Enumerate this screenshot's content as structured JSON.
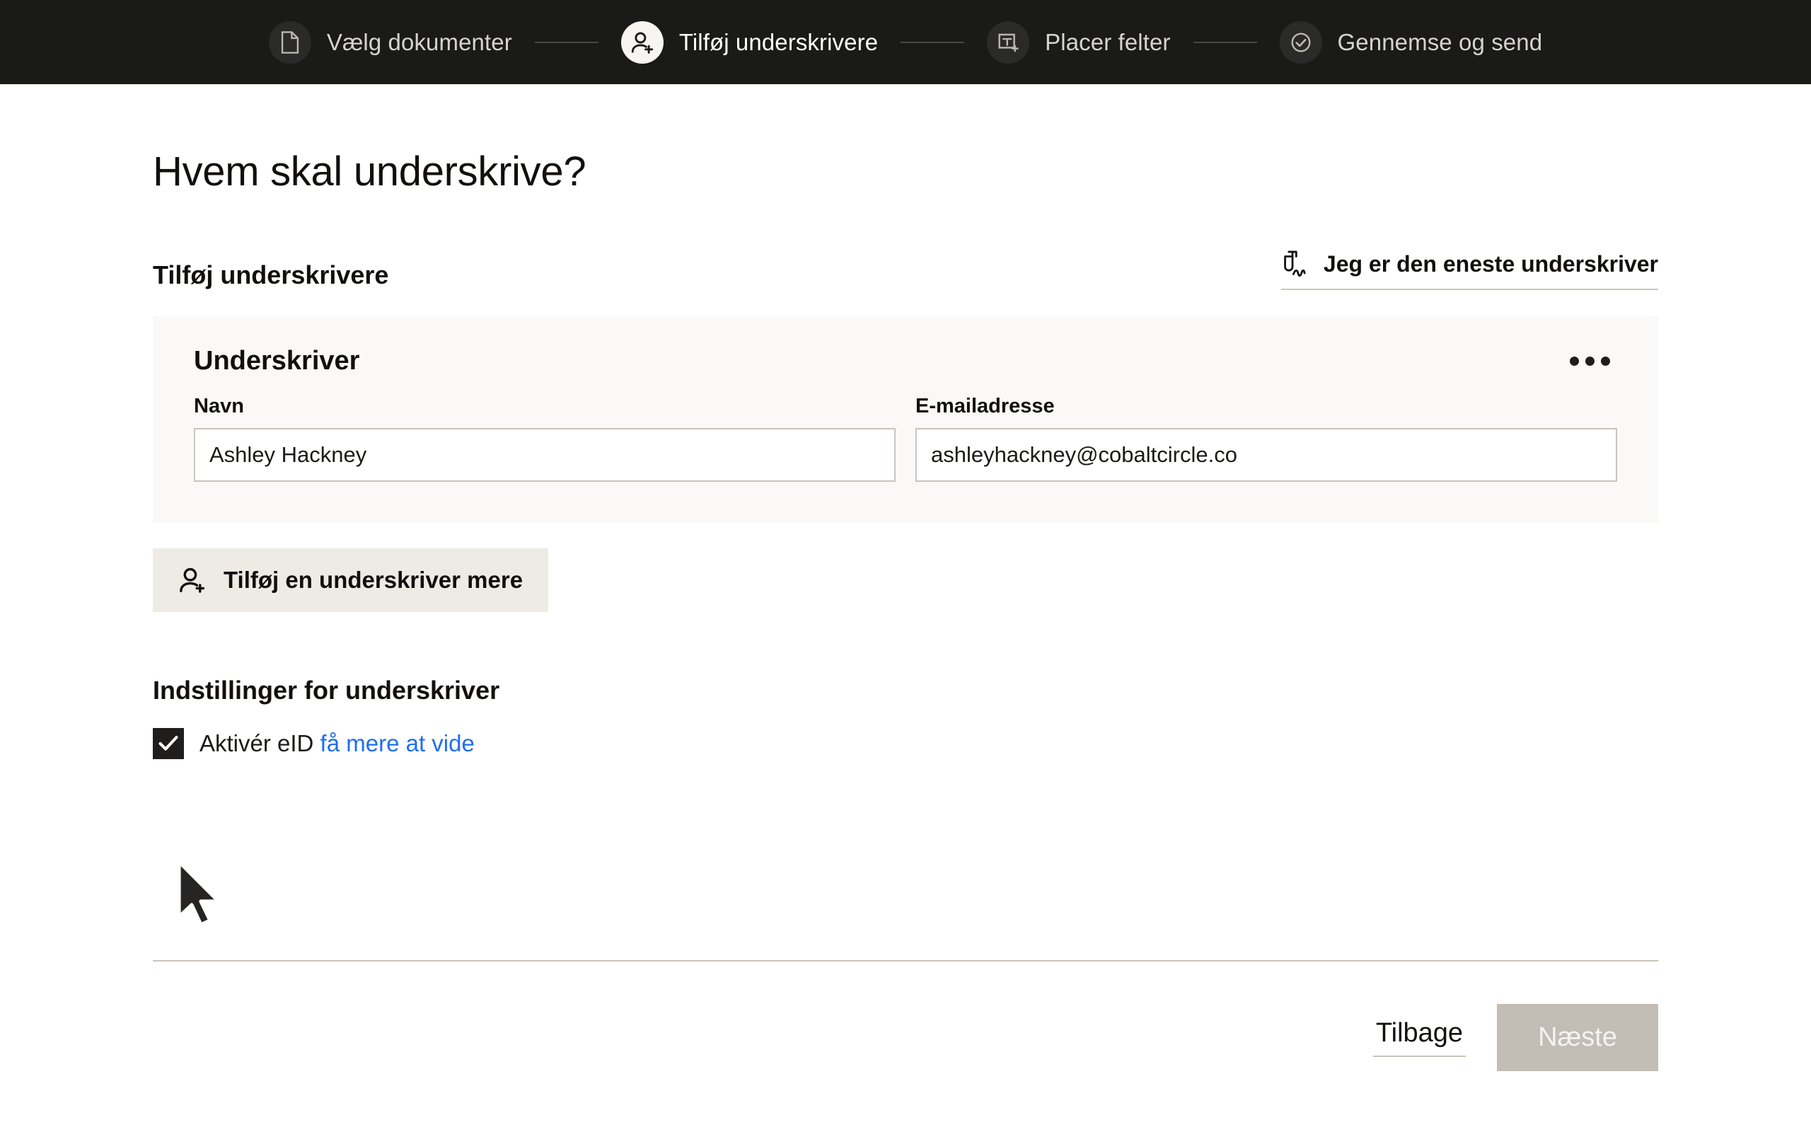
{
  "stepper": {
    "steps": [
      {
        "label": "Vælg dokumenter",
        "icon": "document-icon",
        "state": "complete"
      },
      {
        "label": "Tilføj underskrivere",
        "icon": "person-add-icon",
        "state": "active"
      },
      {
        "label": "Placer felter",
        "icon": "text-field-icon",
        "state": "upcoming"
      },
      {
        "label": "Gennemse og send",
        "icon": "check-circle-icon",
        "state": "upcoming"
      }
    ]
  },
  "main": {
    "page_title": "Hvem skal underskrive?",
    "section_title": "Tilføj underskrivere",
    "sole_signer_link": "Jeg er den eneste underskriver",
    "signer_card": {
      "title": "Underskriver",
      "name_label": "Navn",
      "name_value": "Ashley Hackney",
      "name_placeholder": "Navn",
      "email_label": "E-mailadresse",
      "email_value": "ashleyhackney@cobaltcircle.co",
      "email_placeholder": "E-mailadresse",
      "menu_icon": "ellipsis-icon"
    },
    "add_signer_button": "Tilføj en underskriver mere",
    "settings_title": "Indstillinger for underskriver",
    "eid_checkbox": {
      "label": "Aktivér eID",
      "link_text": "få mere at vide",
      "checked": true
    }
  },
  "footer": {
    "back_label": "Tilbage",
    "next_label": "Næste",
    "next_disabled": true
  },
  "colors": {
    "topbar_bg": "#1a1a18",
    "card_bg": "#faf9f7",
    "button_bg": "#eeebe5",
    "link_blue": "#1f6ef0",
    "checkbox_fill": "#1f1e1c",
    "disabled_button": "#c2bdb5",
    "border": "#c9c5bd"
  }
}
